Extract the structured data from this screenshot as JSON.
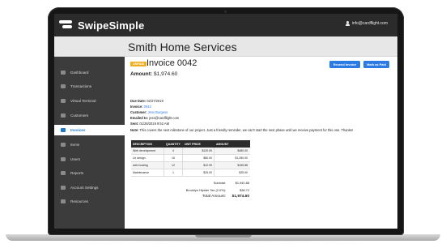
{
  "brand": {
    "name": "SwipeSimple"
  },
  "user": {
    "email": "info@cardflight.com"
  },
  "header": {
    "company": "Smith Home Services"
  },
  "sidebar": {
    "items": [
      {
        "label": "Dashboard",
        "icon": "dashboard-icon"
      },
      {
        "label": "Transactions",
        "icon": "transactions-icon"
      },
      {
        "label": "Virtual Terminal",
        "icon": "terminal-icon"
      },
      {
        "label": "Customers",
        "icon": "customers-icon"
      },
      {
        "label": "Invoices",
        "icon": "invoice-icon"
      },
      {
        "label": "Items",
        "icon": "items-icon"
      },
      {
        "label": "Users",
        "icon": "users-icon"
      },
      {
        "label": "Reports",
        "icon": "reports-icon"
      },
      {
        "label": "Account Settings",
        "icon": "gear-icon"
      },
      {
        "label": "Resources",
        "icon": "resources-icon"
      }
    ],
    "active_index": 4
  },
  "invoice": {
    "status": "UNPAID",
    "title": "Invoice 0042",
    "resend_label": "Resend Invoice",
    "mark_paid_label": "Mark as Paid",
    "amount_label": "Amount:",
    "amount_value": "$1,974.60",
    "due_label": "Due Date:",
    "due_value": "02/27/2019",
    "invoice_label": "Invoice:",
    "invoice_value": "0042",
    "customer_label": "Customer:",
    "customer_value": "Jess Burgess",
    "emailed_label": "Emailed to:",
    "emailed_value": "jess@cardflight.com",
    "sent_label": "Sent:",
    "sent_value": "01/28/2019 9:52 AM",
    "note_label": "Note:",
    "note_value": "This covers the next milestone of our project. Just a friendly reminder, we can't start the next phase until we receive payment for this one. Thanks!"
  },
  "table": {
    "headers": [
      "DESCRIPTION",
      "QUANTITY",
      "UNIT PRICE",
      "AMOUNT"
    ],
    "rows": [
      [
        "Web development",
        "4",
        "$120.00",
        "$480.00"
      ],
      [
        "Ux design",
        "16",
        "$80.00",
        "$1,280.00"
      ],
      [
        "web hosting",
        "12",
        "$12.99",
        "$155.88"
      ],
      [
        "Maintenance",
        "1",
        "$25.00",
        "$25.00"
      ]
    ]
  },
  "totals": {
    "subtotal_label": "Subtotal:",
    "subtotal_value": "$1,940.88",
    "tax_label": "Brooklyn Hipster Tax (2.0%):",
    "tax_value": "$38.72",
    "total_label": "Total Amount:",
    "total_value": "$1,974.60"
  },
  "colors": {
    "accent": "#2c7be5",
    "badge": "#f0ad1e",
    "sidebar": "#3c3c3c",
    "topbar": "#2b2b2b"
  }
}
